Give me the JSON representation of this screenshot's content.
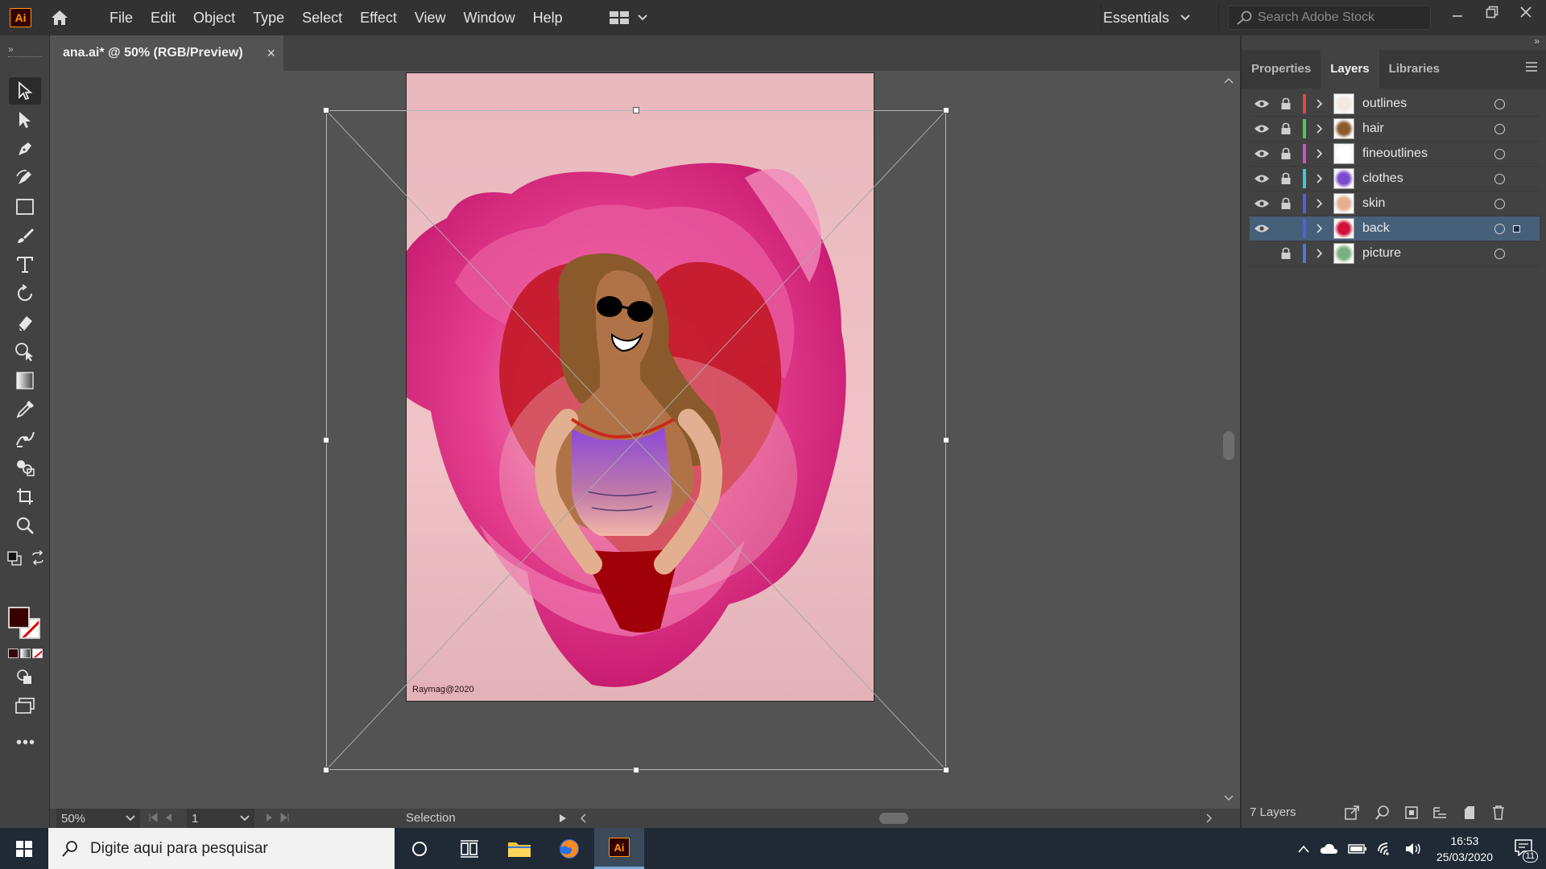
{
  "app": {
    "logo": "Ai",
    "menu": [
      "File",
      "Edit",
      "Object",
      "Type",
      "Select",
      "Effect",
      "View",
      "Window",
      "Help"
    ],
    "workspace": "Essentials",
    "stock_search_placeholder": "Search Adobe Stock"
  },
  "document": {
    "tab_title": "ana.ai* @ 50% (RGB/Preview)",
    "close": "×",
    "credit": "Raymag@2020"
  },
  "status": {
    "zoom": "50%",
    "page": "1",
    "mode": "Selection"
  },
  "panel": {
    "tabs": [
      "Properties",
      "Layers",
      "Libraries"
    ],
    "active_tab": "Layers",
    "layers": [
      {
        "name": "outlines",
        "color": "#e04848",
        "visible": true,
        "locked": true,
        "selected": false
      },
      {
        "name": "hair",
        "color": "#4ccc4c",
        "visible": true,
        "locked": true,
        "selected": false
      },
      {
        "name": "fineoutlines",
        "color": "#d050d0",
        "visible": true,
        "locked": true,
        "selected": false
      },
      {
        "name": "clothes",
        "color": "#40c8d8",
        "visible": true,
        "locked": true,
        "selected": false
      },
      {
        "name": "skin",
        "color": "#5060e0",
        "visible": true,
        "locked": true,
        "selected": false
      },
      {
        "name": "back",
        "color": "#5060e0",
        "visible": true,
        "locked": false,
        "selected": true
      },
      {
        "name": "picture",
        "color": "#4a78e0",
        "visible": false,
        "locked": true,
        "selected": false
      }
    ],
    "layers_count": "7 Layers"
  },
  "taskbar": {
    "search_placeholder": "Digite aqui para pesquisar",
    "time": "16:53",
    "date": "25/03/2020",
    "notifications": "11"
  }
}
